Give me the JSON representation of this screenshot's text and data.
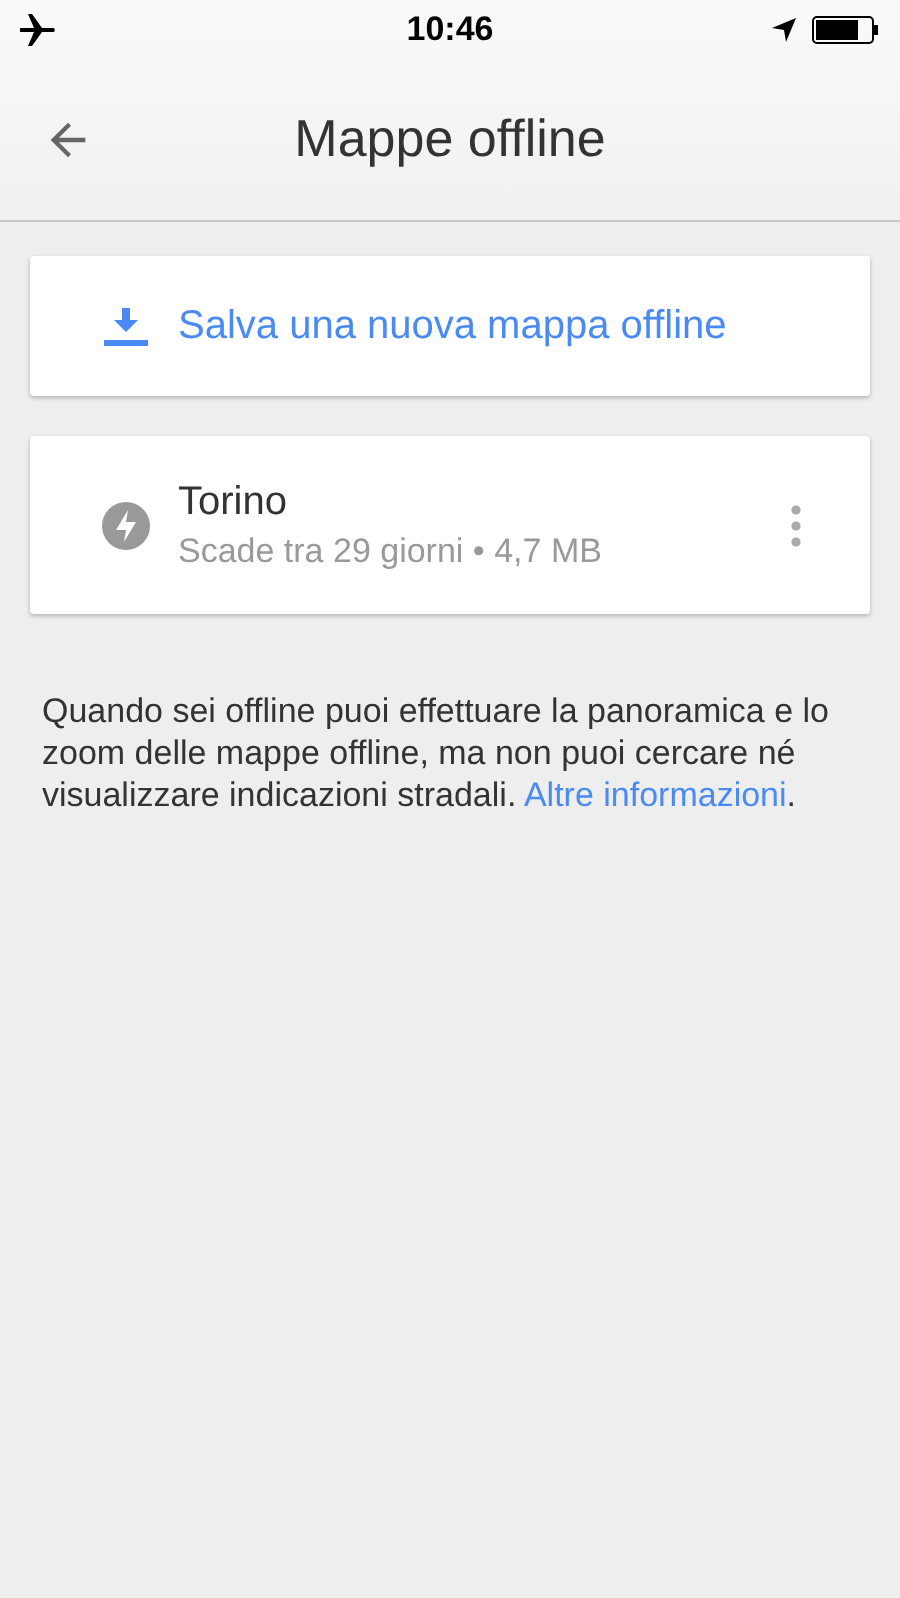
{
  "status_bar": {
    "time": "10:46"
  },
  "header": {
    "title": "Mappe offline"
  },
  "save_action": {
    "label": "Salva una nuova mappa offline"
  },
  "maps": [
    {
      "name": "Torino",
      "details": "Scade tra 29 giorni • 4,7 MB"
    }
  ],
  "info": {
    "text": "Quando sei offline puoi effettuare la panoramica e lo zoom delle mappe offline, ma non puoi cercare né visualizzare indicazioni stradali. ",
    "link": "Altre informazioni",
    "after": "."
  }
}
